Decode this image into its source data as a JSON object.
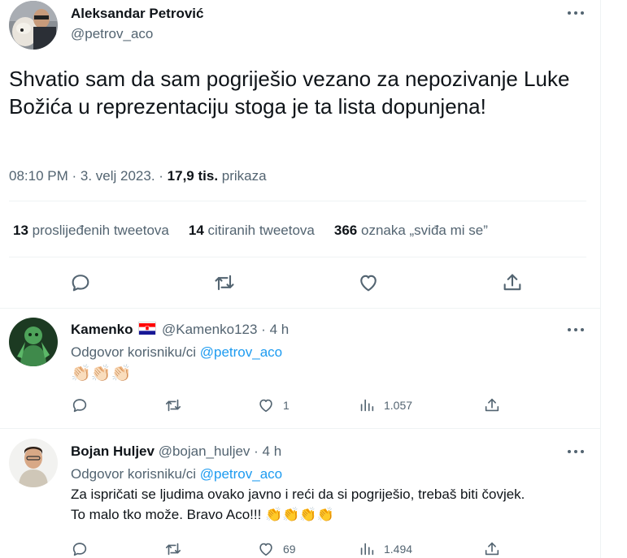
{
  "tweet": {
    "author_name": "Aleksandar Petrović",
    "author_handle": "@petrov_aco",
    "text": "Shvatio sam da sam pogriješio vezano za nepozivanje Luke Božića u reprezentaciju stoga je ta lista dopunjena!",
    "time": "08:10 PM",
    "date": "3. velj 2023.",
    "views_value": "17,9 tis.",
    "views_label": "prikaza",
    "stats": {
      "retweets_count": "13",
      "retweets_label": "proslijeđenih tweetova",
      "quotes_count": "14",
      "quotes_label": "citiranih tweetova",
      "likes_count": "366",
      "likes_label": "oznaka „sviđa mi se”"
    }
  },
  "replies": [
    {
      "name": "Kamenko",
      "handle": "@Kamenko123",
      "time": "4 h",
      "reply_to_label": "Odgovor korisniku/ci",
      "reply_to_handle": "@petrov_aco",
      "text": "👏🏻👏🏻👏🏻",
      "likes": "1",
      "views": "1.057"
    },
    {
      "name": "Bojan Huljev",
      "handle": "@bojan_huljev",
      "time": "4 h",
      "reply_to_label": "Odgovor korisniku/ci",
      "reply_to_handle": "@petrov_aco",
      "text_line1": "Za ispričati se ljudima ovako javno i reći da si pogriješio, trebaš biti čovjek.",
      "text_line2": "To malo tko može. Bravo Aco!!! 👏👏👏👏",
      "likes": "69",
      "views": "1.494"
    }
  ],
  "colors": {
    "text": "#0f1419",
    "secondary": "#536471",
    "link": "#1d9bf0",
    "border": "#eff3f4"
  },
  "icons": [
    "more-icon",
    "reply-icon",
    "retweet-icon",
    "like-icon",
    "share-icon",
    "views-icon",
    "croatia-flag-icon"
  ]
}
